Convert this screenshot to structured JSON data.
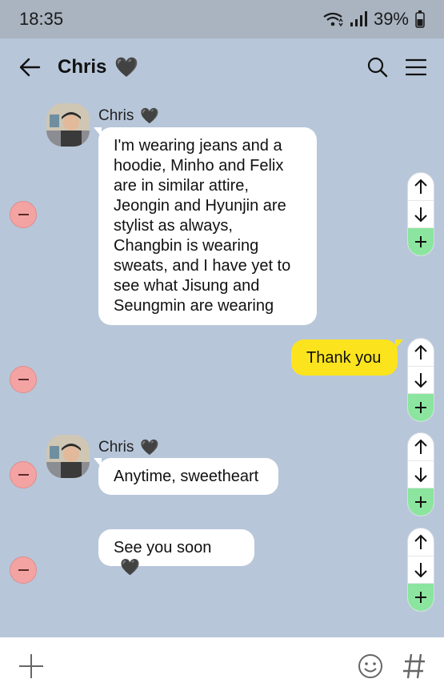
{
  "status": {
    "time": "18:35",
    "battery": "39%"
  },
  "header": {
    "title": "Chris",
    "heart": "🖤"
  },
  "messages": [
    {
      "sender": "Chris",
      "heart": "🖤",
      "text": "I'm wearing jeans and a hoodie, Minho and Felix are in similar attire, Jeongin and Hyunjin are stylist as always, Changbin is wearing sweats, and I have yet to see what Jisung and Seungmin are wearing"
    },
    {
      "text": "Thank you"
    },
    {
      "sender": "Chris",
      "heart": "🖤",
      "text": "Anytime, sweetheart"
    },
    {
      "text": "See you soon",
      "heart": "🖤"
    }
  ],
  "colors": {
    "background": "#b7c6d9",
    "mine_bubble": "#fbe41e",
    "delete": "#f4a3a3",
    "add": "#8be59e"
  }
}
